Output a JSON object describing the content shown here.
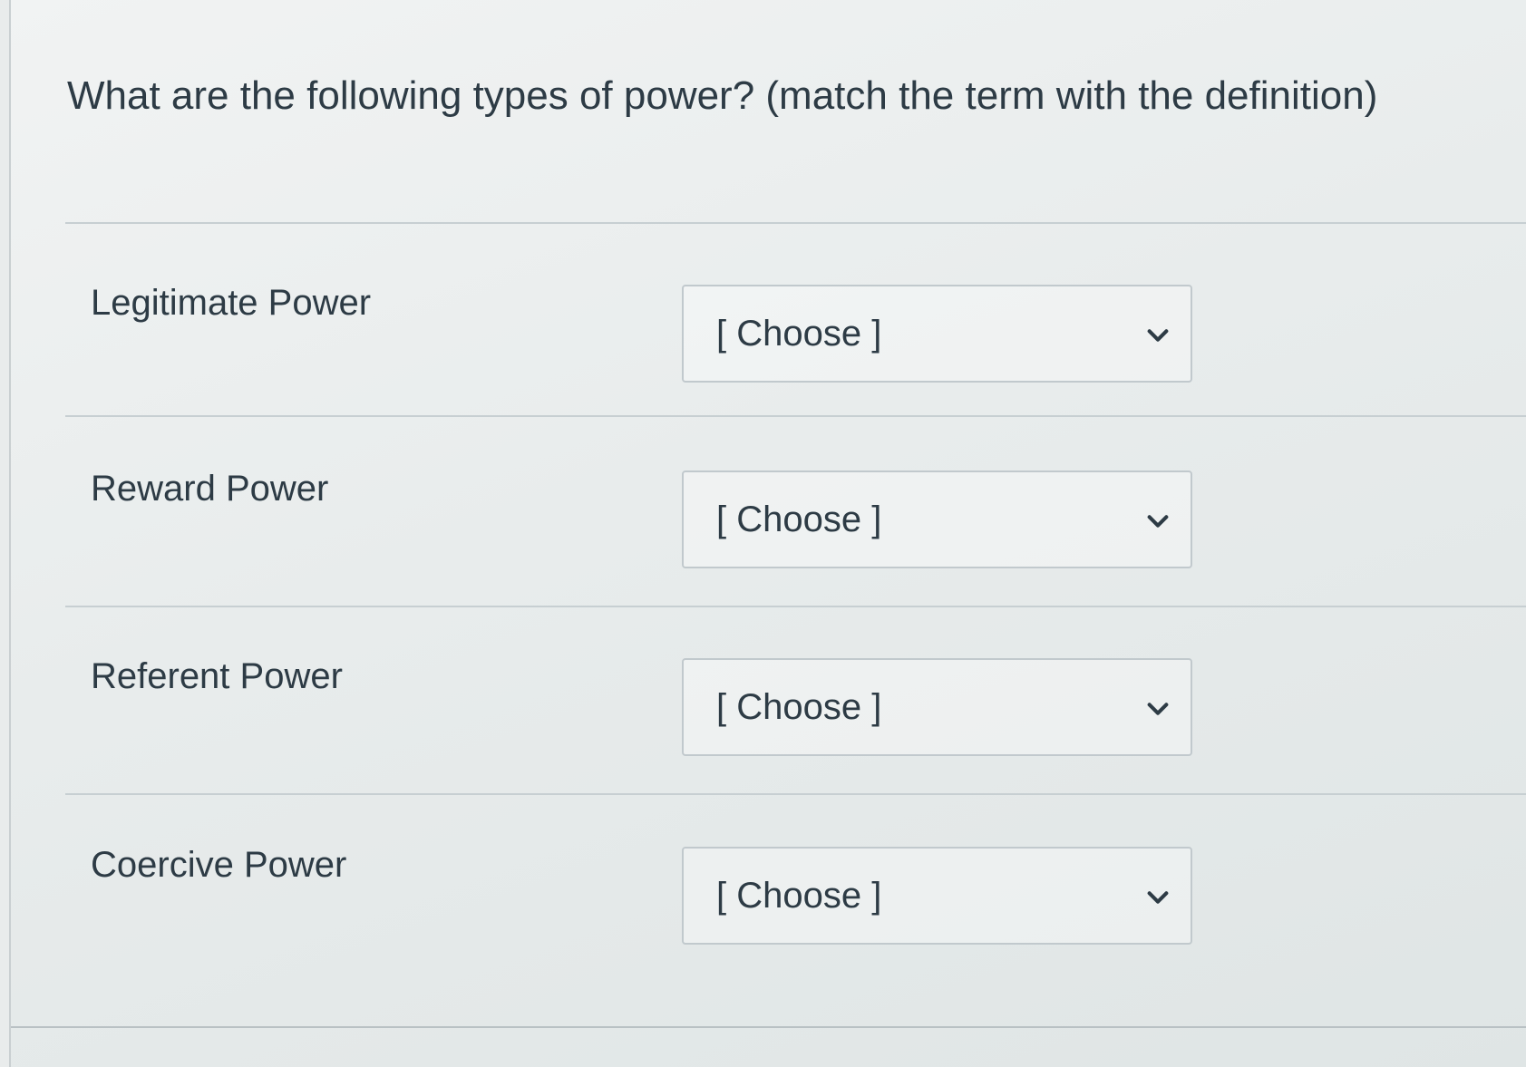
{
  "question": {
    "text": "What are the following types of power? (match the term with the definition)"
  },
  "rows": [
    {
      "label": "Legitimate Power",
      "selected": "[ Choose ]"
    },
    {
      "label": "Reward Power",
      "selected": "[ Choose ]"
    },
    {
      "label": "Referent Power",
      "selected": "[ Choose ]"
    },
    {
      "label": "Coercive Power",
      "selected": "[ Choose ]"
    }
  ],
  "icons": {
    "dropdown": "chevron-down-icon"
  },
  "colors": {
    "text": "#2d3b45",
    "border": "#c1c9cd"
  }
}
